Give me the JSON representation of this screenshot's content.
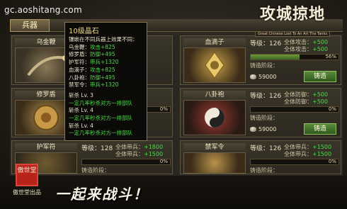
{
  "header": {
    "site_url": "gc.aoshitang.com",
    "game_title": "攻城掠地",
    "game_subtitle": "Great Chinese Lost To An Art The Tanks"
  },
  "tabs": [
    {
      "label": "兵器",
      "active": true
    }
  ],
  "cards": [
    {
      "name": "乌金鞭",
      "level_label": "等级",
      "level": "",
      "stats": [],
      "progress_pct": "",
      "forge_label": "",
      "forge_value": "",
      "cost": "",
      "button": ""
    },
    {
      "name": "血滴子",
      "level_label": "等级：",
      "level": "126",
      "stats": [
        {
          "k": "全体攻击：",
          "v": "+500"
        },
        {
          "k": "全体攻击：",
          "v": "+500"
        }
      ],
      "progress_pct": "56%",
      "progress_fraction": 0.56,
      "forge_label": "铸造阶段：",
      "forge_value": "",
      "cost": "59000",
      "button": "铸造"
    },
    {
      "name": "修罗盾",
      "level_label": "",
      "level": "",
      "stats": [],
      "progress_pct": "0%",
      "progress_fraction": 0,
      "forge_label": "",
      "forge_value": "",
      "cost": "",
      "button": ""
    },
    {
      "name": "八卦袍",
      "level_label": "等级：",
      "level": "126",
      "stats": [
        {
          "k": "全体防御：",
          "v": "+500"
        },
        {
          "k": "全体防御：",
          "v": "+500"
        }
      ],
      "progress_pct": "0%",
      "progress_fraction": 0,
      "forge_label": "铸造阶段：",
      "forge_value": "",
      "cost": "59000",
      "button": "铸造"
    },
    {
      "name": "护军符",
      "level_label": "等级：",
      "level": "128",
      "stats": [
        {
          "k": "全体带兵：",
          "v": "+1800"
        },
        {
          "k": "全体带兵：",
          "v": "+1500"
        }
      ],
      "progress_pct": "0%",
      "progress_fraction": 0,
      "forge_label": "铸造阶段：",
      "forge_value": "",
      "cost": "",
      "button": ""
    },
    {
      "name": "禁军令",
      "level_label": "等级：",
      "level": "126",
      "stats": [
        {
          "k": "全体带兵：",
          "v": "+1500"
        },
        {
          "k": "全体带兵：",
          "v": "+1500"
        }
      ],
      "progress_pct": "0%",
      "progress_fraction": 0,
      "forge_label": "铸造阶段：",
      "forge_value": "",
      "cost": "",
      "button": ""
    }
  ],
  "tooltip": {
    "title": "10级晶石",
    "desc": "镶嵌在不同兵器上效果不同：",
    "effects": [
      {
        "k": "乌金鞭：",
        "v": "攻击+825"
      },
      {
        "k": "修罗盾：",
        "v": "防御+495"
      },
      {
        "k": "护军符：",
        "v": "带兵+1320"
      },
      {
        "k": "血滴子：",
        "v": "攻击+825"
      },
      {
        "k": "八卦袍：",
        "v": "防御+495"
      },
      {
        "k": "禁军令：",
        "v": "带兵+1320"
      }
    ],
    "skills": [
      {
        "name": "斩杀 Lv. 3",
        "desc": "一定几率秒杀对方一排部队"
      },
      {
        "name": "斩杀 Lv. 4",
        "desc": "一定几率秒杀对方一排部队"
      },
      {
        "name": "斩杀 Lv. 4",
        "desc": "一定几率秒杀对方一排部队"
      }
    ]
  },
  "footer": {
    "seal_text": "傲世堂",
    "brand": "傲世堂出品",
    "slogan": "一起来战斗！"
  }
}
